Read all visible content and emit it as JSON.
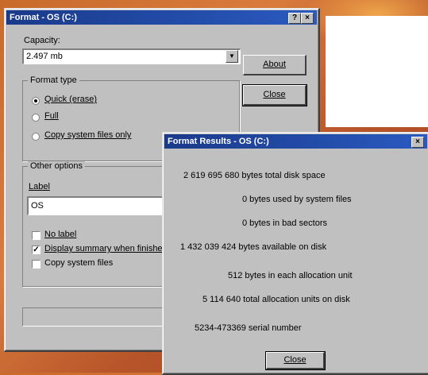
{
  "format_dialog": {
    "title": "Format - OS (C:)",
    "help_btn": "?",
    "close_btn": "×",
    "capacity_label": "Capacity:",
    "capacity_value": "2.497 mb",
    "format_type_label": "Format type",
    "radio_quick": "Quick (erase)",
    "radio_full": "Full",
    "radio_copy": "Copy system files only",
    "other_options_label": "Other options",
    "label_label": "Label",
    "label_value": "OS",
    "check_nolabel": "No label",
    "check_summary": "Display summary when finished",
    "check_copy": "Copy system files",
    "about_btn": "About",
    "close_button": "Close"
  },
  "results_dialog": {
    "title": "Format Results - OS (C:)",
    "close_btn": "×",
    "lines": [
      "2 619 695 680 bytes total disk space",
      "0 bytes used by system files",
      "0 bytes in bad sectors",
      "1 432 039 424 bytes available on disk",
      "512 bytes in each allocation unit",
      "5 114 640 total allocation units on disk",
      "5234-473369 serial number"
    ],
    "close_button": "Close"
  },
  "colors": {
    "titlebar": "#1a3a8a",
    "window_face": "#c0c0c0",
    "background": "#c86a2a"
  }
}
